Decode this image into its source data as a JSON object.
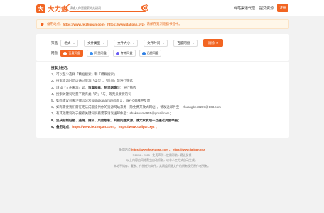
{
  "header": {
    "logo_mark": "大",
    "logo_text": "大力盘",
    "search_placeholder": "请输入你要搜索的关键词",
    "nav": [
      "网站渠道代理",
      "提交资源"
    ],
    "register_label": "注册"
  },
  "notice": {
    "prefix": "备用站点：",
    "url1": "https://www.feizhupan.com",
    "sep": " ，",
    "url2": "https://www.dalipan.xyz",
    "suffix": "，请保存到浏览器书签中。"
  },
  "filters": {
    "label_filter": "筛选:",
    "dropdowns": [
      "格式",
      "文件类型",
      "文件大小",
      "文件时间",
      "百度网盘"
    ],
    "clear_label": "清除",
    "label_site": "网盘:",
    "sites": [
      {
        "name": "百度网盘",
        "active": true,
        "color": "#ffffff"
      },
      {
        "name": "阿里网盘",
        "active": false,
        "color": "#3a8fef"
      },
      {
        "name": "夸克网盘",
        "active": false,
        "color": "#6a5cf4"
      },
      {
        "name": "迅雷网盘",
        "active": false,
        "color": "#2e7fe3"
      }
    ]
  },
  "tips": {
    "title": "搜索小技巧：",
    "items": [
      "1、可以至少选择「精准搜索」和「模糊搜索」",
      "2、搜索资源时可以通过资源「类型」、「时间」等进行筛选",
      "3、增加「文件来源」如：",
      "4、搜索关键词尽量不要有类「的」「与」等无关紧要的词",
      "5、如有建议可关注微信公众号shakanamo945留言，或在QQ群中反馈",
      "6、如有需要我们需在无法成都提供你的资源网站来源（除免费开放式网站），请发送邮件至：zhuangbee6287@163.com",
      "7、有其他建议对于搜索关键词屏蔽需求请发送邮件至：shakaname945@gmail.com；",
      "8、坚决抵制低俗、违规、隐私、风险版权、其他问题资源，请大家发现一旦通过页面举报；",
      "9、备用站点"
    ],
    "item3_em1": "百度网盘",
    "item3_sep": "、",
    "item3_em2": "阿里网盘",
    "item3_tail": "等）进行筛选",
    "item9_url1": "https://www.feizhupan.com",
    "item9_sep": "，",
    "item9_url2": "https://www.dalipan.xyz",
    "item9_tail": "；"
  },
  "footer": {
    "line1_prefix": "备用站点",
    "line1_url1": "https://www.feizhupan.com",
    "line1_sep": "，",
    "line1_url2": "https://www.dalipan.xyz",
    "line2": "©2016 - 2025 - 免责声明 - 使用帮助 - 建议反馈",
    "line3": "以上内容由网络爬虫自动抓取，以非人工方式自动生成。",
    "line4": "本站不储存、复制、传播任何文件，其网盘资源文件的所有权归原作者所有。"
  }
}
